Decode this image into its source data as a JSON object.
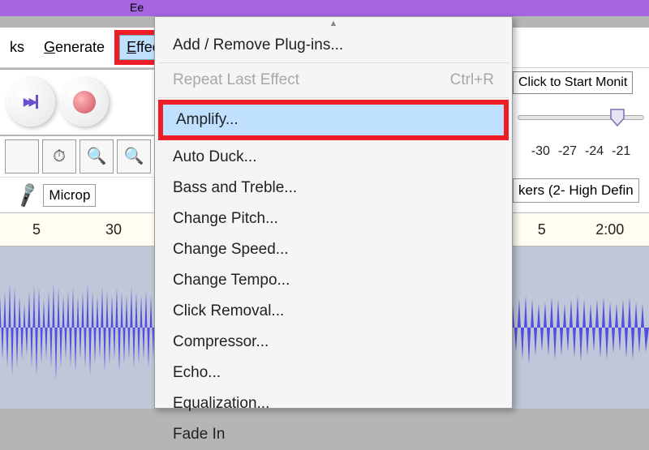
{
  "title": "Ee",
  "menubar": {
    "tracks": "ks",
    "generate": "Generate",
    "effect": "Effect"
  },
  "mic": {
    "label": "Microp"
  },
  "ruler_left": {
    "t1": "5",
    "t2": "30"
  },
  "ruler_right": {
    "t1": "5",
    "t2": "2:00"
  },
  "right": {
    "monitor": "Click to Start Monit",
    "scale": [
      "-30",
      "-27",
      "-24",
      "-21"
    ],
    "speakers": "kers (2- High Defin"
  },
  "dropdown": {
    "up_arrow": "▲",
    "items": [
      {
        "label": "Add / Remove Plug-ins...",
        "type": "item"
      },
      {
        "label": "",
        "type": "sep"
      },
      {
        "label": "Repeat Last Effect",
        "type": "disabled",
        "shortcut": "Ctrl+R"
      },
      {
        "label": "",
        "type": "sep"
      },
      {
        "label": "Amplify...",
        "type": "highlight"
      },
      {
        "label": "Auto Duck...",
        "type": "item"
      },
      {
        "label": "Bass and Treble...",
        "type": "item"
      },
      {
        "label": "Change Pitch...",
        "type": "item"
      },
      {
        "label": "Change Speed...",
        "type": "item"
      },
      {
        "label": "Change Tempo...",
        "type": "item"
      },
      {
        "label": "Click Removal...",
        "type": "item"
      },
      {
        "label": "Compressor...",
        "type": "item"
      },
      {
        "label": "Echo...",
        "type": "item"
      },
      {
        "label": "Equalization...",
        "type": "item"
      },
      {
        "label": "Fade In",
        "type": "item"
      }
    ]
  }
}
